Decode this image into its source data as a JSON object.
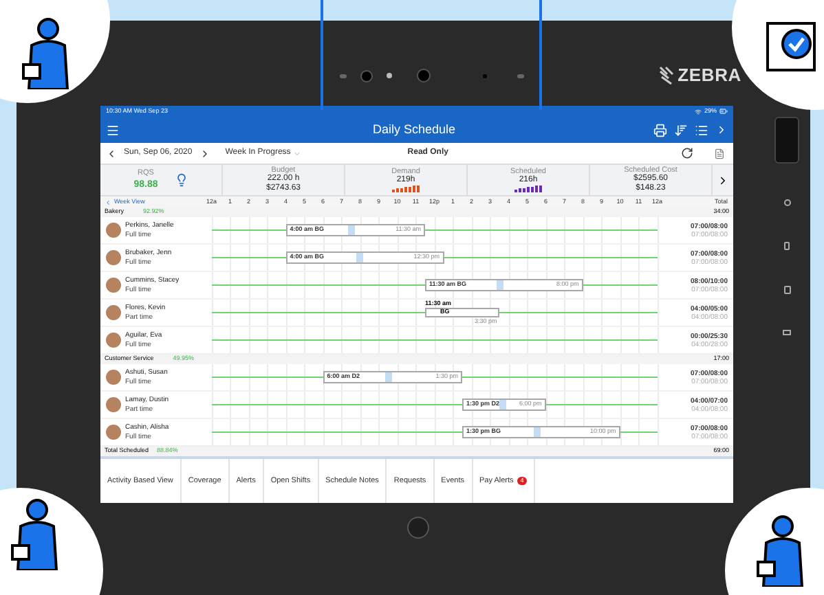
{
  "status_bar": {
    "time": "10:30 AM  Wed Sep 23",
    "battery": "29%"
  },
  "title_bar": {
    "title": "Daily Schedule"
  },
  "date_bar": {
    "date": "Sun, Sep 06, 2020",
    "view": "Week In Progress",
    "mode": "Read Only"
  },
  "logo": {
    "text": "ZEBRA"
  },
  "stats": [
    {
      "kind": "rqs",
      "label": "RQS",
      "value": "98.88"
    },
    {
      "kind": "plain",
      "label": "Budget",
      "value": "222.00 h",
      "sub": "$2743.63"
    },
    {
      "kind": "chart",
      "label": "Demand",
      "value": "219h",
      "color": "#d9541e"
    },
    {
      "kind": "chart",
      "label": "Scheduled",
      "value": "216h",
      "color": "#6a2bb5"
    },
    {
      "kind": "plain",
      "label": "Scheduled Cost",
      "value": "$2595.60",
      "sub": "$148.23"
    }
  ],
  "timeline": {
    "back": "Week View",
    "hours": [
      "12a",
      "1",
      "2",
      "3",
      "4",
      "5",
      "6",
      "7",
      "8",
      "9",
      "10",
      "11",
      "12p",
      "1",
      "2",
      "3",
      "4",
      "5",
      "6",
      "7",
      "8",
      "9",
      "10",
      "11",
      "12a"
    ],
    "total": "Total"
  },
  "groups": [
    {
      "name": "Bakery",
      "percent": "92.92%",
      "total": "34:00",
      "employees": [
        {
          "name": "Perkins, Janelle",
          "type": "Full time",
          "hours": "07:00/08:00",
          "planned": "07:00/08:00",
          "shift": {
            "kind": "inline",
            "start": "4:00 am",
            "code": "BG",
            "end": "11:30 am"
          }
        },
        {
          "name": "Brubaker, Jenn",
          "type": "Full time",
          "hours": "07:00/08:00",
          "planned": "07:00/08:00",
          "shift": {
            "kind": "inline",
            "start": "4:00 am",
            "code": "BG",
            "end": "12:30 pm"
          }
        },
        {
          "name": "Cummins, Stacey",
          "type": "Full time",
          "hours": "08:00/10:00",
          "planned": "07:00/08:00",
          "shift": {
            "kind": "inline",
            "start": "11:30 am",
            "code": "BG",
            "end": "8:00 pm"
          }
        },
        {
          "name": "Flores, Kevin",
          "type": "Part time",
          "hours": "04:00/05:00",
          "planned": "04:00/08:00",
          "shift": {
            "kind": "stacked",
            "start": "11:30 am",
            "code": "BG",
            "end": "3:30 pm"
          }
        },
        {
          "name": "Aguilar, Eva",
          "type": "Full time",
          "hours": "00:00/25:30",
          "planned": "04:00/28:00"
        }
      ]
    },
    {
      "name": "Customer Service",
      "percent": "49.95%",
      "total": "17:00",
      "employees": [
        {
          "name": "Ashuti, Susan",
          "type": "Full time",
          "hours": "07:00/08:00",
          "planned": "07:00/08:00",
          "shift": {
            "kind": "inline",
            "start": "6:00 am",
            "code": "D2",
            "end": "1:30 pm"
          }
        },
        {
          "name": "Lamay, Dustin",
          "type": "Part time",
          "hours": "04:00/07:00",
          "planned": "04:00/08:00",
          "shift": {
            "kind": "inline",
            "start": "1:30 pm",
            "code": "D2",
            "end": "6:00 pm"
          }
        },
        {
          "name": "Cashin, Alisha",
          "type": "Full time",
          "hours": "07:00/08:00",
          "planned": "07:00/08:00",
          "shift": {
            "kind": "inline",
            "start": "1:30 pm",
            "code": "BG",
            "end": "10:00 pm"
          }
        }
      ]
    }
  ],
  "summary": {
    "label": "Total Scheduled",
    "percent": "88.84%",
    "total": "69:00"
  },
  "tabs": [
    {
      "label": "Activity Based View",
      "selected": false
    },
    {
      "label": "Coverage",
      "selected": false
    },
    {
      "label": "Alerts",
      "selected": false
    },
    {
      "label": "Open Shifts",
      "selected": false
    },
    {
      "label": "Schedule Notes",
      "selected": false
    },
    {
      "label": "Requests",
      "selected": false
    },
    {
      "label": "Events",
      "selected": false
    },
    {
      "label": "Pay Alerts",
      "badge": "4",
      "selected": false
    }
  ]
}
